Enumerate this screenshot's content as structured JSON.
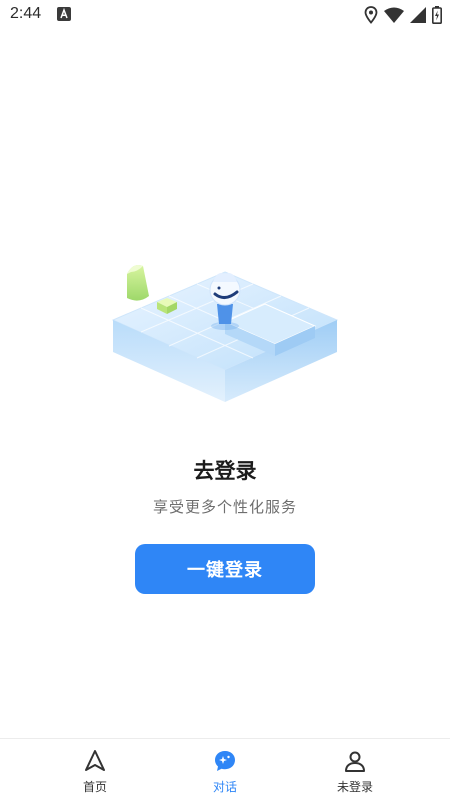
{
  "status_bar": {
    "time": "2:44",
    "notification_icon": "a-letter-icon",
    "icons": [
      "location-icon",
      "wifi-icon",
      "signal-icon",
      "battery-icon"
    ]
  },
  "illustration": {
    "name": "isometric-glass-blocks-illustration"
  },
  "login": {
    "title": "去登录",
    "subtitle": "享受更多个性化服务",
    "button_label": "一键登录"
  },
  "nav": {
    "items": [
      {
        "label": "首页",
        "icon": "navigation-arrow-icon",
        "active": false
      },
      {
        "label": "对话",
        "icon": "chat-bubble-icon",
        "active": true
      },
      {
        "label": "未登录",
        "icon": "person-icon",
        "active": false
      }
    ]
  },
  "colors": {
    "accent": "#2f86f6",
    "background": "#ffffff",
    "subtitle": "#6e6e6e"
  }
}
